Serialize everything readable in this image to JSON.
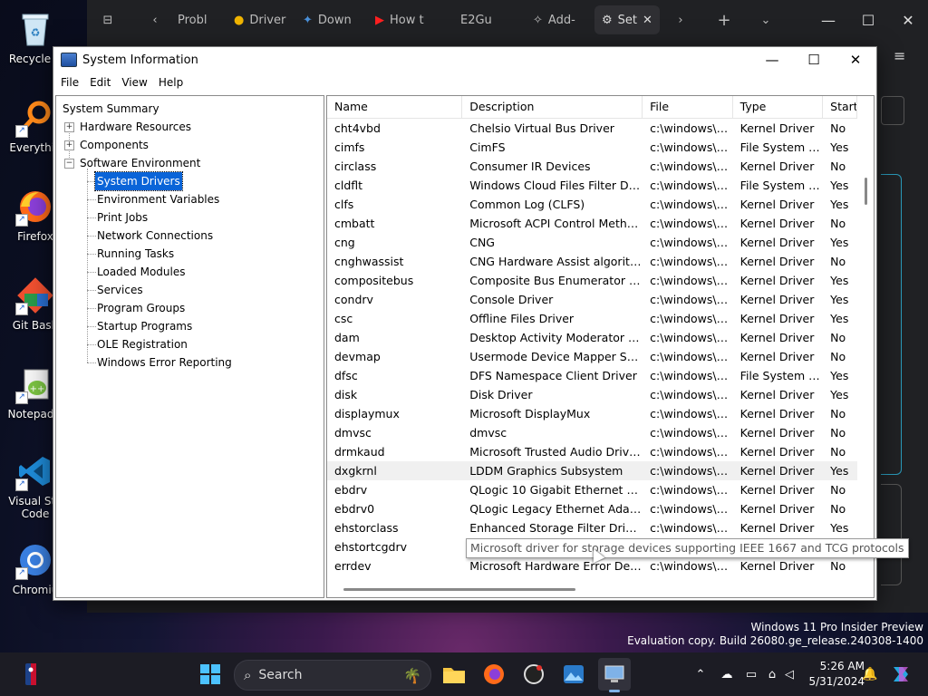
{
  "desktop": {
    "icons": [
      {
        "label": "Recycle B",
        "icon": "recycle-bin-icon"
      },
      {
        "label": "Everythin",
        "icon": "everything-search-icon"
      },
      {
        "label": "Firefox",
        "icon": "firefox-icon"
      },
      {
        "label": "Git Bash",
        "icon": "git-bash-icon"
      },
      {
        "label": "Notepad+",
        "icon": "notepad-plus-plus-icon"
      },
      {
        "label": "Visual Stu",
        "label2": "Code",
        "icon": "vscode-icon"
      },
      {
        "label": "Chromiu",
        "icon": "chromium-icon"
      }
    ]
  },
  "browser": {
    "tabs": [
      {
        "label": "Probl",
        "icon": "page-icon"
      },
      {
        "label": "Driver",
        "icon": "chrome-icon"
      },
      {
        "label": "Down",
        "icon": "bird-icon"
      },
      {
        "label": "How t",
        "icon": "youtube-icon"
      },
      {
        "label": "E2Gu",
        "icon": "page-icon"
      },
      {
        "label": "Add-",
        "icon": "puzzle-icon"
      },
      {
        "label": "Set",
        "icon": "gear-icon",
        "active": true
      }
    ]
  },
  "window": {
    "title": "System Information",
    "menu": [
      "File",
      "Edit",
      "View",
      "Help"
    ]
  },
  "tree": {
    "root": "System Summary",
    "nodes": [
      {
        "label": "Hardware Resources",
        "expander": "+"
      },
      {
        "label": "Components",
        "expander": "+"
      },
      {
        "label": "Software Environment",
        "expander": "−"
      }
    ],
    "children": [
      "System Drivers",
      "Environment Variables",
      "Print Jobs",
      "Network Connections",
      "Running Tasks",
      "Loaded Modules",
      "Services",
      "Program Groups",
      "Startup Programs",
      "OLE Registration",
      "Windows Error Reporting"
    ],
    "selected": "System Drivers"
  },
  "table": {
    "columns": [
      "Name",
      "Description",
      "File",
      "Type",
      "Start"
    ],
    "rows": [
      [
        "cht4vbd",
        "Chelsio Virtual Bus Driver",
        "c:\\windows\\s...",
        "Kernel Driver",
        "No"
      ],
      [
        "cimfs",
        "CimFS",
        "c:\\windows\\s...",
        "File System D...",
        "Yes"
      ],
      [
        "circlass",
        "Consumer IR Devices",
        "c:\\windows\\s...",
        "Kernel Driver",
        "No"
      ],
      [
        "cldflt",
        "Windows Cloud Files Filter Driv...",
        "c:\\windows\\s...",
        "File System D...",
        "Yes"
      ],
      [
        "clfs",
        "Common Log (CLFS)",
        "c:\\windows\\s...",
        "Kernel Driver",
        "Yes"
      ],
      [
        "cmbatt",
        "Microsoft ACPI Control Metho...",
        "c:\\windows\\s...",
        "Kernel Driver",
        "No"
      ],
      [
        "cng",
        "CNG",
        "c:\\windows\\s...",
        "Kernel Driver",
        "Yes"
      ],
      [
        "cnghwassist",
        "CNG Hardware Assist algorith...",
        "c:\\windows\\s...",
        "Kernel Driver",
        "No"
      ],
      [
        "compositebus",
        "Composite Bus Enumerator Dr...",
        "c:\\windows\\s...",
        "Kernel Driver",
        "Yes"
      ],
      [
        "condrv",
        "Console Driver",
        "c:\\windows\\s...",
        "Kernel Driver",
        "Yes"
      ],
      [
        "csc",
        "Offline Files Driver",
        "c:\\windows\\s...",
        "Kernel Driver",
        "Yes"
      ],
      [
        "dam",
        "Desktop Activity Moderator Dr...",
        "c:\\windows\\s...",
        "Kernel Driver",
        "No"
      ],
      [
        "devmap",
        "Usermode Device Mapper Ser...",
        "c:\\windows\\s...",
        "Kernel Driver",
        "No"
      ],
      [
        "dfsc",
        "DFS Namespace Client Driver",
        "c:\\windows\\s...",
        "File System D...",
        "Yes"
      ],
      [
        "disk",
        "Disk Driver",
        "c:\\windows\\s...",
        "Kernel Driver",
        "Yes"
      ],
      [
        "displaymux",
        "Microsoft DisplayMux",
        "c:\\windows\\s...",
        "Kernel Driver",
        "No"
      ],
      [
        "dmvsc",
        "dmvsc",
        "c:\\windows\\s...",
        "Kernel Driver",
        "No"
      ],
      [
        "drmkaud",
        "Microsoft Trusted Audio Drivers",
        "c:\\windows\\s...",
        "Kernel Driver",
        "No"
      ],
      [
        "dxgkrnl",
        "LDDM Graphics Subsystem",
        "c:\\windows\\s...",
        "Kernel Driver",
        "Yes"
      ],
      [
        "ebdrv",
        "QLogic 10 Gigabit Ethernet Ad...",
        "c:\\windows\\s...",
        "Kernel Driver",
        "No"
      ],
      [
        "ebdrv0",
        "QLogic Legacy Ethernet Adapt...",
        "c:\\windows\\s...",
        "Kernel Driver",
        "No"
      ],
      [
        "ehstorclass",
        "Enhanced Storage Filter Driver",
        "c:\\windows\\s...",
        "Kernel Driver",
        "Yes"
      ],
      [
        "ehstortcgdrv",
        "",
        "",
        "",
        ""
      ],
      [
        "errdev",
        "Microsoft Hardware Error Dev...",
        "c:\\windows\\s...",
        "Kernel Driver",
        "No"
      ]
    ],
    "hover_row": 18
  },
  "tooltip": "Microsoft driver for storage devices supporting IEEE 1667 and TCG protocols",
  "watermark": {
    "line1": "Windows 11 Pro Insider Preview",
    "line2": "Evaluation copy. Build 26080.ge_release.240308-1400"
  },
  "taskbar": {
    "search_placeholder": "Search",
    "time": "5:26 AM",
    "date": "5/31/2024"
  }
}
